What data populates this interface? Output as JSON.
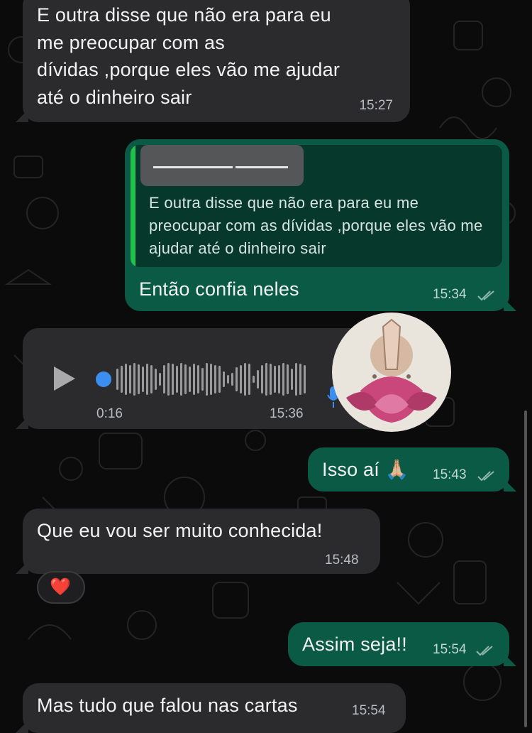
{
  "messages": [
    {
      "id": "m1",
      "dir": "in",
      "lines": [
        "E outra disse que não era para eu",
        "me preocupar com as",
        "dívidas ,porque eles vão me ajudar",
        "até o dinheiro sair"
      ],
      "time": "15:27"
    },
    {
      "id": "m2",
      "dir": "out",
      "quote": {
        "text": "E outra disse que não era para eu me preocupar com as dívidas ,porque eles vão me ajudar até o dinheiro sair"
      },
      "text": "Então confia neles",
      "time": "15:34"
    },
    {
      "id": "m3",
      "dir": "in",
      "type": "voice",
      "duration": "0:16",
      "time": "15:36"
    },
    {
      "id": "m4",
      "dir": "out",
      "text": "Isso aí 🙏🏼",
      "time": "15:43"
    },
    {
      "id": "m5",
      "dir": "in",
      "text": "Que eu vou ser muito conhecida!",
      "time": "15:48",
      "reaction": "❤️"
    },
    {
      "id": "m6",
      "dir": "out",
      "text": "Assim seja!!",
      "time": "15:54"
    },
    {
      "id": "m7",
      "dir": "in",
      "text": "Mas tudo que falou nas cartas",
      "time": "15:54"
    }
  ],
  "colors": {
    "incoming": "#2b2b2d",
    "outgoing": "#0a5a45",
    "quote_bar": "#1fc24b",
    "play_dot": "#3b8ef0"
  }
}
